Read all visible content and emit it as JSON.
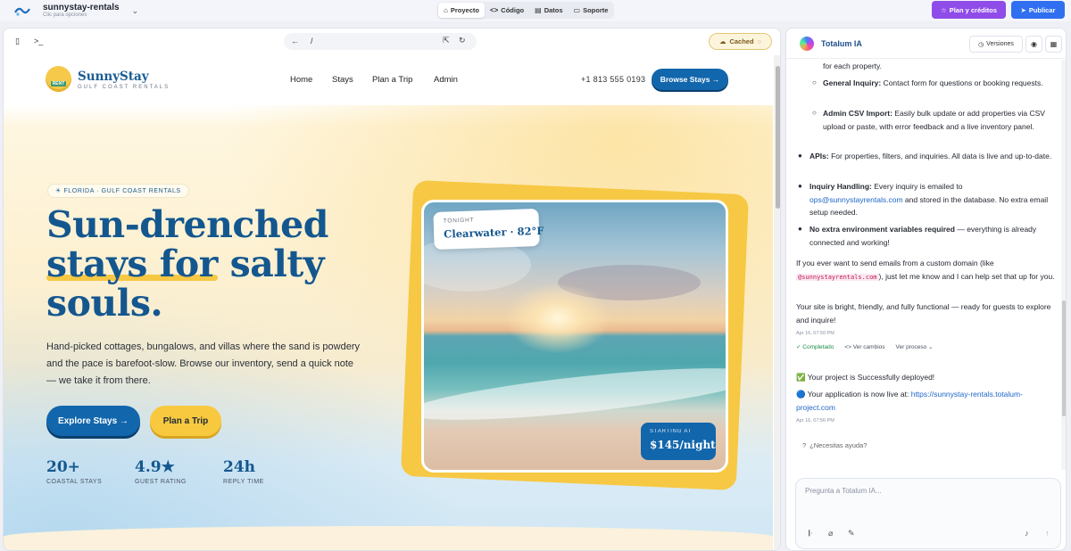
{
  "app": {
    "project_name": "sunnystay-rentals",
    "project_subtitle": "Clic para opciones",
    "logo_icon": "wave-logo-icon",
    "tabs": [
      {
        "label": "Proyecto",
        "icon": "home-icon",
        "active": true
      },
      {
        "label": "Código",
        "icon": "code-icon",
        "active": false
      },
      {
        "label": "Datos",
        "icon": "database-icon",
        "active": false
      },
      {
        "label": "Soporte",
        "icon": "chat-icon",
        "active": false
      }
    ],
    "plan_label": "Plan y créditos",
    "publish_label": "Publicar",
    "colors": {
      "plan": "#8f4ce8",
      "publish": "#2f6ff0"
    }
  },
  "preview": {
    "url_path": "/",
    "cached_label": "Cached",
    "site": {
      "brand_name": "SunnyStay",
      "brand_tagline": "GULF COAST RENTALS",
      "badge_text": "RENT",
      "nav": [
        "Home",
        "Stays",
        "Plan a Trip",
        "Admin"
      ],
      "phone": "+1 813 555 0193",
      "browse_label": "Browse Stays →",
      "pill": "☀ FLORIDA · GULF COAST RENTALS",
      "headline_1": "Sun-drenched",
      "headline_2a": "stays for",
      "headline_2b": " salty",
      "headline_3": "souls.",
      "lede": "Hand-picked cottages, bungalows, and villas where the sand is powdery and the pace is barefoot-slow. Browse our inventory, send a quick note — we take it from there.",
      "cta_primary": "Explore Stays →",
      "cta_secondary": "Plan a Trip",
      "stats": [
        {
          "value": "20+",
          "label": "COASTAL STAYS"
        },
        {
          "value": "4.9★",
          "label": "GUEST RATING"
        },
        {
          "value": "24h",
          "label": "REPLY TIME"
        }
      ],
      "tonight_label": "TONIGHT",
      "tonight_value": "Clearwater · 82°F",
      "price_label": "STARTING AT",
      "price_value": "$145/night",
      "colors": {
        "primary": "#1266ac",
        "accent": "#f7c843",
        "heading": "#14578f"
      }
    }
  },
  "chat": {
    "title": "Totalum IA",
    "versions_label": "Versiones",
    "messages": {
      "frag_top": "for each property.",
      "general_inquiry_b": "General Inquiry:",
      "general_inquiry_t": " Contact form for questions or booking requests.",
      "admin_csv_b": "Admin CSV Import:",
      "admin_csv_t": " Easily bulk update or add properties via CSV upload or paste, with error feedback and a live inventory panel.",
      "apis_b": "APIs:",
      "apis_t": " For properties, filters, and inquiries. All data is live and up-to-date.",
      "inquiry_b": "Inquiry Handling:",
      "inquiry_t1": " Every inquiry is emailed to ",
      "inquiry_email": "ops@sunnystayrentals.com",
      "inquiry_t2": " and stored in the database. No extra email setup needed.",
      "noenv_b": "No extra environment variables required",
      "noenv_t": " — everything is already connected and working!",
      "domain_t1": "If you ever want to send emails from a custom domain (like ",
      "domain_code": "@sunnystayrentals.com",
      "domain_t2": "), just let me know and I can help set that up for you.",
      "bright": "Your site is bright, friendly, and fully functional — ready for guests to explore and inquire!",
      "time_1": "Apr 16, 07:50 PM",
      "status_completed": "Completado",
      "view_changes": "Ver cambios",
      "view_process": "Ver proceso",
      "deployed": "✅ Your project is Successfully deployed!",
      "live_t": "🔵 Your application is now live at: ",
      "live_link": "https://sunnystay-rentals.totalum-project.com",
      "time_2": "Apr 16, 07:56 PM"
    },
    "help_label": "¿Necesitas ayuda?",
    "input_placeholder": "Pregunta a Totalum IA..."
  }
}
